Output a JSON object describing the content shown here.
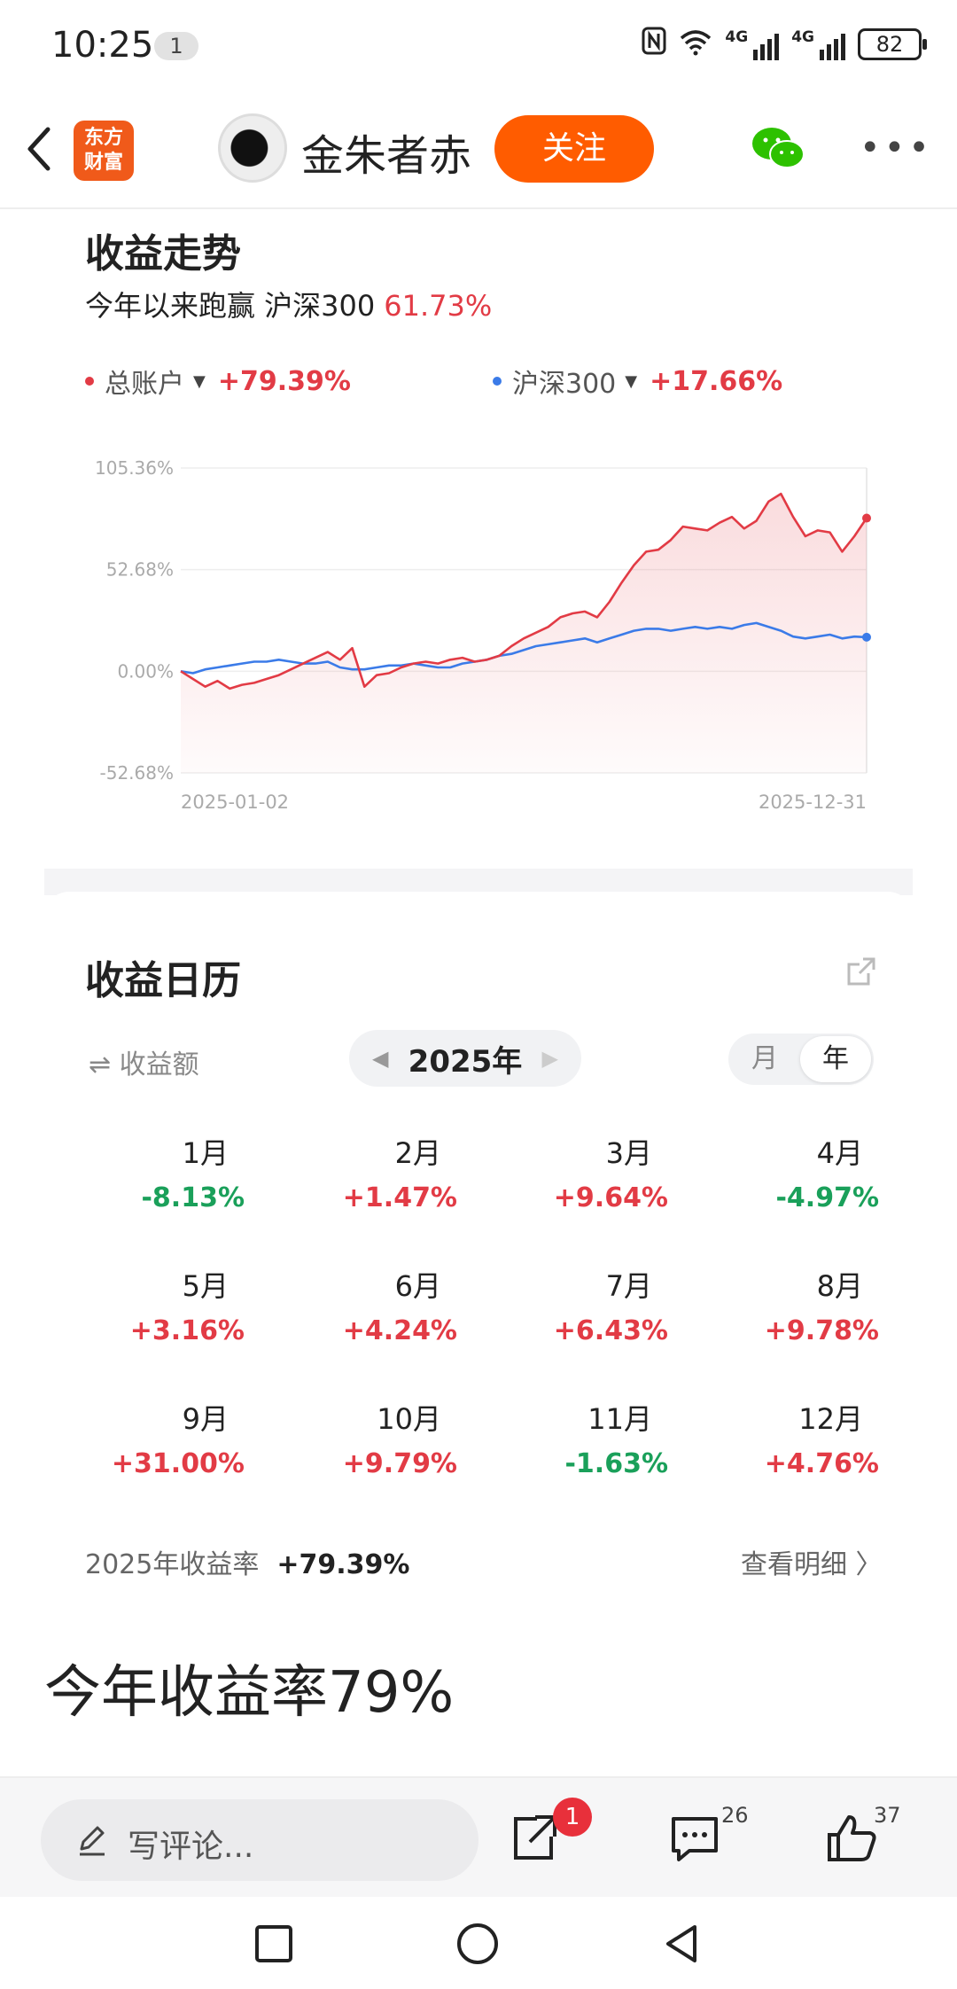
{
  "status_bar": {
    "time": "10:25",
    "notification_count": "1",
    "battery": "82",
    "network_tag": "4G"
  },
  "header": {
    "logo_line1": "东方",
    "logo_line2": "财富",
    "author": "金朱者赤",
    "follow_label": "关注"
  },
  "chart_section": {
    "title": "收益走势",
    "beat_label": "今年以来跑赢 沪深300",
    "beat_value": "61.73%",
    "legend": [
      {
        "name": "总账户",
        "value": "+79.39%",
        "color": "#e23b45"
      },
      {
        "name": "沪深300",
        "value": "+17.66%",
        "color": "#3b7be8"
      }
    ]
  },
  "chart_data": {
    "type": "line",
    "x_labels": [
      "2025-01-02",
      "2025-12-31"
    ],
    "y_ticks": [
      "105.36%",
      "52.68%",
      "0.00%",
      "-52.68%"
    ],
    "ylim": [
      -52.68,
      105.36
    ],
    "series": [
      {
        "name": "总账户",
        "color": "#e23b45",
        "values": [
          0,
          -4,
          -8,
          -5,
          -9,
          -7,
          -6,
          -4,
          -2,
          1,
          4,
          7,
          10,
          6,
          12,
          -8,
          -2,
          -1,
          2,
          4,
          5,
          4,
          6,
          7,
          5,
          6,
          8,
          13,
          17,
          20,
          23,
          28,
          30,
          31,
          28,
          36,
          46,
          55,
          62,
          63,
          68,
          75,
          74,
          73,
          77,
          80,
          74,
          78,
          88,
          92,
          80,
          70,
          73,
          72,
          62,
          70,
          79.39
        ]
      },
      {
        "name": "沪深300",
        "color": "#3b7be8",
        "values": [
          0,
          -1,
          1,
          2,
          3,
          4,
          5,
          5,
          6,
          5,
          4,
          4,
          5,
          2,
          1,
          1,
          2,
          3,
          3,
          4,
          3,
          2,
          2,
          4,
          5,
          6,
          8,
          9,
          11,
          13,
          14,
          15,
          16,
          17,
          15,
          17,
          19,
          21,
          22,
          22,
          21,
          22,
          23,
          22,
          23,
          22,
          24,
          25,
          23,
          21,
          18,
          17,
          18,
          19,
          17,
          18,
          17.66
        ]
      }
    ]
  },
  "calendar": {
    "title": "收益日历",
    "metric_toggle": "⇌ 收益额",
    "year": "2025年",
    "seg_month": "月",
    "seg_year": "年",
    "months": [
      {
        "month": "1月",
        "return": "-8.13%",
        "sign": "neg"
      },
      {
        "month": "2月",
        "return": "+1.47%",
        "sign": "pos"
      },
      {
        "month": "3月",
        "return": "+9.64%",
        "sign": "pos"
      },
      {
        "month": "4月",
        "return": "-4.97%",
        "sign": "neg"
      },
      {
        "month": "5月",
        "return": "+3.16%",
        "sign": "pos"
      },
      {
        "month": "6月",
        "return": "+4.24%",
        "sign": "pos"
      },
      {
        "month": "7月",
        "return": "+6.43%",
        "sign": "pos"
      },
      {
        "month": "8月",
        "return": "+9.78%",
        "sign": "pos"
      },
      {
        "month": "9月",
        "return": "+31.00%",
        "sign": "pos"
      },
      {
        "month": "10月",
        "return": "+9.79%",
        "sign": "pos"
      },
      {
        "month": "11月",
        "return": "-1.63%",
        "sign": "neg"
      },
      {
        "month": "12月",
        "return": "+4.76%",
        "sign": "pos"
      }
    ],
    "summary_label": "2025年收益率",
    "summary_value": "+79.39%",
    "detail_link": "查看明细 〉"
  },
  "post": {
    "text": "今年收益率79%"
  },
  "action_bar": {
    "comment_placeholder": "写评论...",
    "share_badge": "1",
    "comment_count": "26",
    "like_count": "37"
  },
  "colors": {
    "accent": "#ff5c00",
    "up": "#e23b45",
    "down": "#1aa05a",
    "benchmark": "#3b7be8"
  }
}
